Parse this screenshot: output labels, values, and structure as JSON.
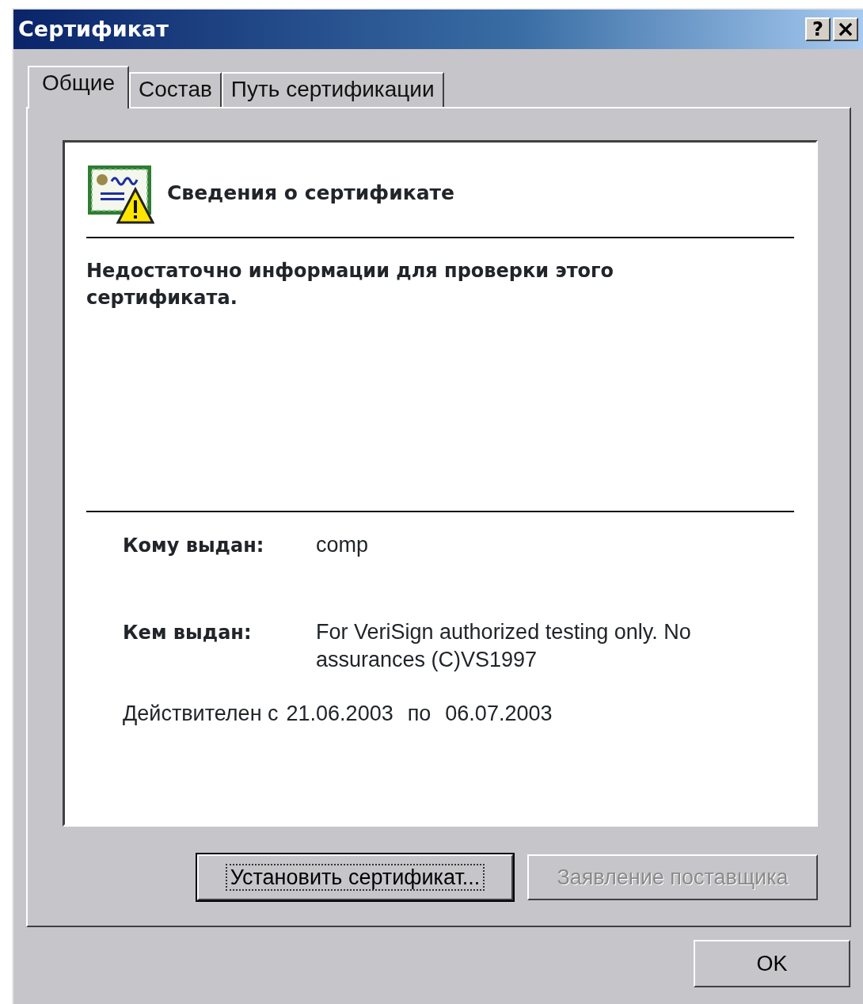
{
  "window": {
    "title": "Сертификат",
    "title_buttons": [
      {
        "kind": "help",
        "label": "?"
      },
      {
        "kind": "close",
        "label": "×"
      }
    ]
  },
  "tabs": [
    {
      "label": "Общие",
      "selected": true
    },
    {
      "label": "Состав",
      "selected": false
    },
    {
      "label": "Путь сертификации",
      "selected": false
    }
  ],
  "info": {
    "heading": "Сведения о сертификате",
    "message": "Недостаточно информации для проверки этого сертификата.",
    "fields": [
      {
        "label": "Кому выдан:",
        "value": "comp"
      },
      {
        "label": "Кем выдан:",
        "value": "For VeriSign authorized testing only. No assurances (C)VS1997"
      }
    ],
    "validity": {
      "prefix": "Действителен с",
      "from": "21.06.2003",
      "to_label": "по",
      "to": "06.07.2003"
    }
  },
  "buttons": [
    {
      "label": "Установить сертификат...",
      "focused": true,
      "disabled": false
    },
    {
      "label": "Заявление поставщика",
      "focused": false,
      "disabled": true
    }
  ],
  "ok_button": {
    "label": "OK"
  }
}
